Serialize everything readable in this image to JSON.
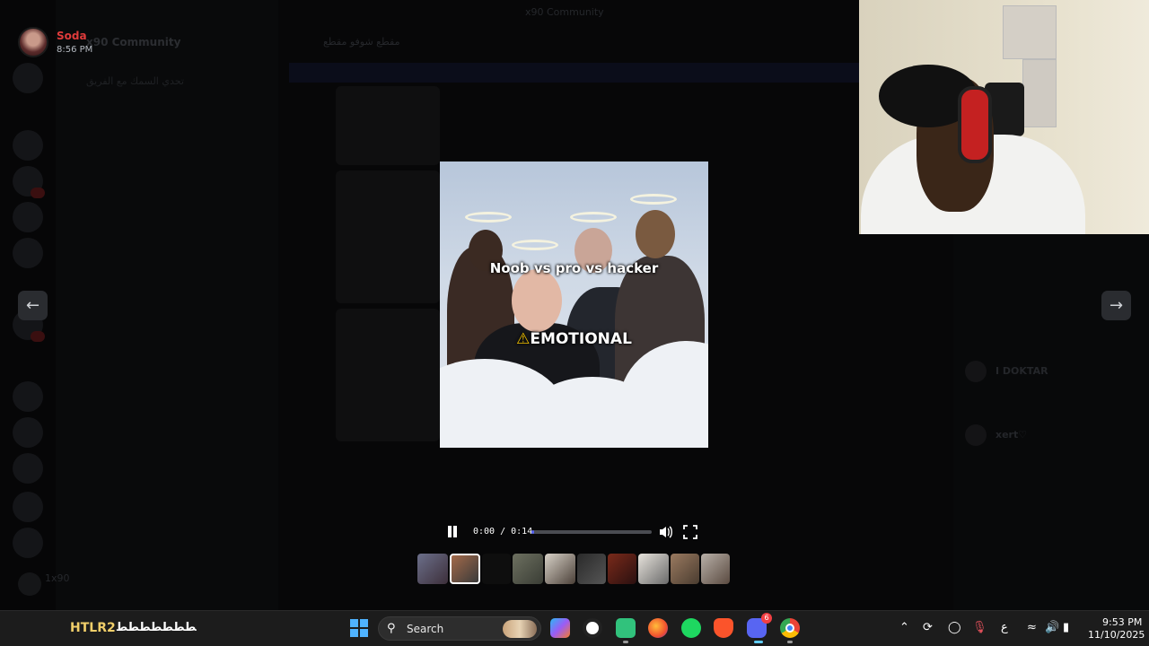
{
  "backdrop": {
    "window_title": "x90 Community",
    "server_name": "x90 Community",
    "channel_header": "مقطع شوفو مقطع",
    "banner_text": "",
    "channels": [
      "تحدي السمك مع الفريق",
      "",
      "",
      "",
      "",
      "",
      "",
      "",
      "",
      "",
      "",
      ""
    ],
    "members": [
      "",
      "I DOKTAR",
      "xert♡",
      ""
    ],
    "user_panel_name": "1x90"
  },
  "uploader": {
    "name": "Soda",
    "time": "8:56 PM"
  },
  "video": {
    "title_text": "Noob vs pro vs hacker",
    "warning_icon": "⚠",
    "warning_text": "EMOTIONAL",
    "current_time": "0:00",
    "duration": "0:14",
    "time_display": "0:00 / 0:14",
    "progress_fraction": 0.02
  },
  "taskbar": {
    "widget_title": "HTLR2",
    "widget_text": "ﻄﻄﻄﻄﻄﻄﻄ",
    "search_label": "Search",
    "discord_badge": "6",
    "clock_time": "9:53 PM",
    "clock_date": "11/10/2025",
    "lang_indicator": "ع",
    "apps": [
      "start",
      "search",
      "copilot",
      "obs",
      "streamlabs",
      "firefox",
      "spotify",
      "brave",
      "discord",
      "chrome"
    ]
  },
  "colors": {
    "accent": "#5865f2",
    "uploader_name": "#e03b3b",
    "widget_title": "#f1cf6a"
  }
}
